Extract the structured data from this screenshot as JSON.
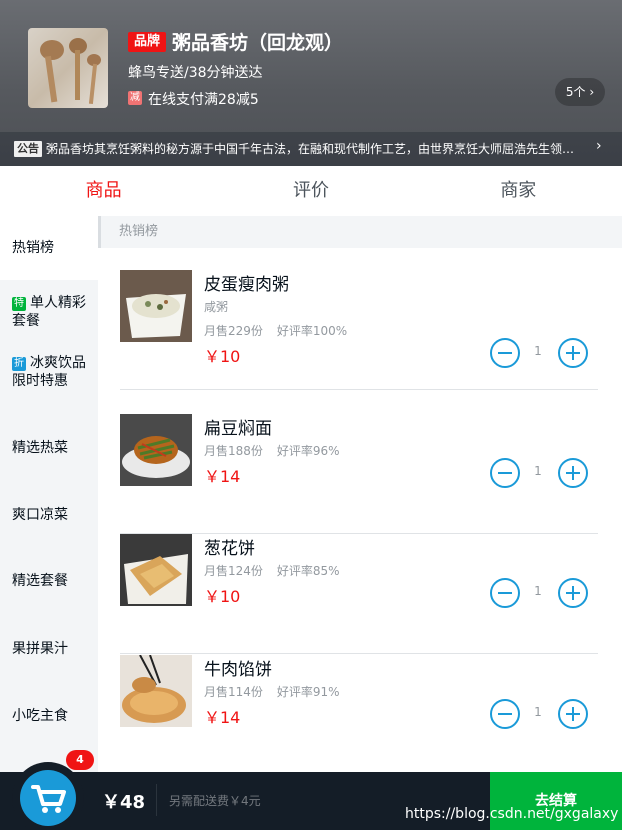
{
  "header": {
    "brand_badge": "品牌",
    "shop_name": "粥品香坊（回龙观）",
    "delivery": "蜂鸟专送/38分钟送达",
    "promo_icon": "减",
    "promo_text": "在线支付满28减5",
    "promo_count": "5个 ›",
    "bulletin_tag": "公告",
    "bulletin_text": "粥品香坊其烹饪粥料的秘方源于中国千年古法，在融和现代制作工艺，由世界烹饪大师屈浩先生领衔研发。",
    "bulletin_arrow": "›"
  },
  "tabs": [
    {
      "label": "商品"
    },
    {
      "label": "评价"
    },
    {
      "label": "商家"
    }
  ],
  "menu": [
    {
      "label": "热销榜"
    },
    {
      "label": "单人精彩套餐",
      "icon": "特",
      "icon_color": "#00b43c"
    },
    {
      "label": "冰爽饮品限时特惠",
      "icon": "折",
      "icon_color": "#1a9ad8"
    },
    {
      "label": "精选热菜"
    },
    {
      "label": "爽口凉菜"
    },
    {
      "label": "精选套餐"
    },
    {
      "label": "果拼果汁"
    },
    {
      "label": "小吃主食"
    }
  ],
  "list_title": "热销榜",
  "foods": [
    {
      "name": "皮蛋瘦肉粥",
      "desc": "咸粥",
      "sales": "月售229份",
      "rating": "好评率100%",
      "price": "￥10",
      "count": "1"
    },
    {
      "name": "扁豆焖面",
      "desc": "",
      "sales": "月售188份",
      "rating": "好评率96%",
      "price": "￥14",
      "count": "1"
    },
    {
      "name": "葱花饼",
      "desc": "",
      "sales": "月售124份",
      "rating": "好评率85%",
      "price": "￥10",
      "count": "1"
    },
    {
      "name": "牛肉馅饼",
      "desc": "",
      "sales": "月售114份",
      "rating": "好评率91%",
      "price": "￥14",
      "count": "1"
    }
  ],
  "cart": {
    "badge": "4",
    "total": "￥48",
    "fee": "另需配送费￥4元",
    "checkout": "去结算"
  },
  "watermark": "https://blog.csdn.net/gxgalaxy",
  "colors": {
    "accent": "#1a9ad8",
    "price": "#f01414",
    "checkout": "#00b43c"
  }
}
